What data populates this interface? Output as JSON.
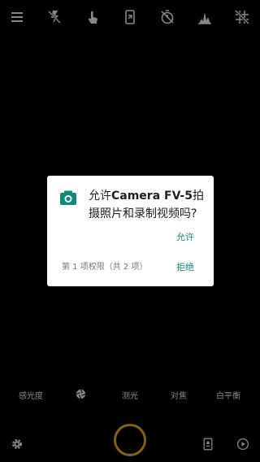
{
  "colors": {
    "background": "#000000",
    "icon": "#cfcfcf",
    "accent": "#0f8a7e",
    "shutter_ring": "#c8971a"
  },
  "topbar": {
    "icons": [
      "menu-icon",
      "flash-off-icon",
      "touch-icon",
      "phone-rotate-icon",
      "timer-off-icon",
      "histogram-icon",
      "grid-off-icon"
    ]
  },
  "dialog": {
    "icon": "camera-icon",
    "title_prefix": "允许",
    "title_app": "Camera FV-5",
    "title_suffix": "拍摄照片和录制视频吗?",
    "allow_label": "允许",
    "permission_count": "第 1 项权限（共 2 项）",
    "deny_label": "拒绝"
  },
  "controls": {
    "iso_label": "感光度",
    "aperture_icon": "aperture-icon",
    "metering_label": "测光",
    "focus_label": "对焦",
    "white_balance_label": "白平衡"
  },
  "bottom": {
    "icons": [
      "settings-icon",
      "shutter-button",
      "camera-switch-icon",
      "play-icon"
    ]
  }
}
